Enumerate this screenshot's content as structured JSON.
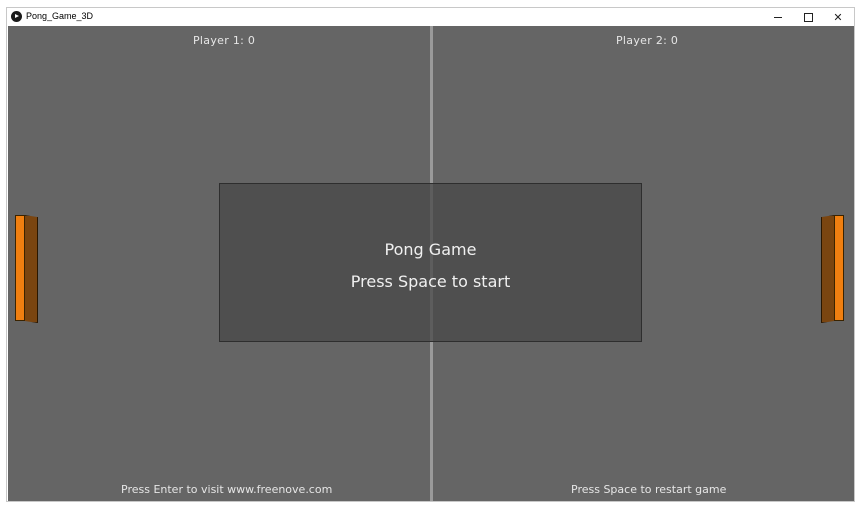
{
  "window": {
    "title": "Pong_Game_3D",
    "minimize_glyph": "–",
    "maximize_glyph": "□",
    "close_glyph": "✕"
  },
  "scoreboard": {
    "player1": "Player 1: 0",
    "player2": "Player 2: 0"
  },
  "overlay": {
    "title": "Pong Game",
    "subtitle": "Press Space to start"
  },
  "footer": {
    "left": "Press Enter to visit www.freenove.com",
    "right": "Press Space to restart game"
  },
  "colors": {
    "field": "#656565",
    "paddle_face": "#f07f10",
    "paddle_side": "#7a4510",
    "divider": "#9a9a9a"
  },
  "icons": {
    "app": "play-circle-icon"
  }
}
